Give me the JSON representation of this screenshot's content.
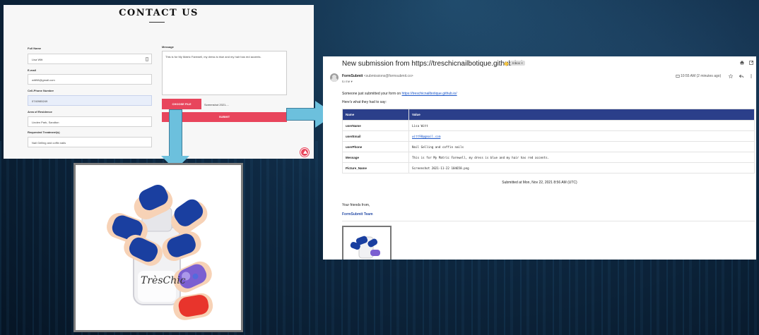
{
  "contact_form": {
    "title": "CONTACT US",
    "full_name_label": "Full Name",
    "full_name_value": "Lisa Witt",
    "email_label": "E-mail",
    "email_value": "witt98@gmail.com",
    "cell_label": "Cell-Phone Number",
    "cell_value": "0740985249",
    "area_label": "Area of Residence",
    "area_value": "Linden Park, Sandton",
    "treatment_label": "Requested Treatment(s)",
    "treatment_value": "Nail Gelling and coffin nails",
    "message_label": "Message",
    "message_value": "This is for My Matric Farewell, my dress is blue and my hair has red accents.",
    "choose_file_label": "CHOOSE FILE",
    "chosen_file": "Screenshot 2021-...",
    "submit_label": "SUBMIT",
    "accent_color": "#e8455c"
  },
  "email": {
    "subject": "New submission from https://treschicnailbotique.github.io/",
    "inbox_tag": "Inbox ×",
    "sender_name": "FormSubmit",
    "sender_email": "<submissions@formsubmit.co>",
    "to": "to me ▾",
    "time": "10:55 AM (2 minutes ago)",
    "intro_text": "Someone just submitted your form on",
    "intro_link": "https://treschicnailbotique.github.io/",
    "said_text": "Here's what they had to say:",
    "col_name": "Name",
    "col_value": "Value",
    "rows": [
      {
        "name": "userName",
        "value": "Lisa Witt"
      },
      {
        "name": "userEmail",
        "value": "witt98@gmail.com"
      },
      {
        "name": "userPhone",
        "value": "Nail Gelling and coffin nails"
      },
      {
        "name": "Message",
        "value": "This is for My Matric Farewell, my dress is blue and my hair has red accents."
      },
      {
        "name": "Picture_Name",
        "value": "Screenshot 2021-11-22 104658.png"
      }
    ],
    "submitted_at": "Submitted at Mon, Nov 22, 2021 8:56 AM (UTC)",
    "friends": "Your friends from,",
    "team": "FormSubmit Team",
    "header_color": "#2b3f8a"
  },
  "preview_image": {
    "logo_text": "TrèsChic",
    "nail_colors": [
      "#1a3fa0",
      "#e8342c",
      "#7b5fd1"
    ]
  }
}
